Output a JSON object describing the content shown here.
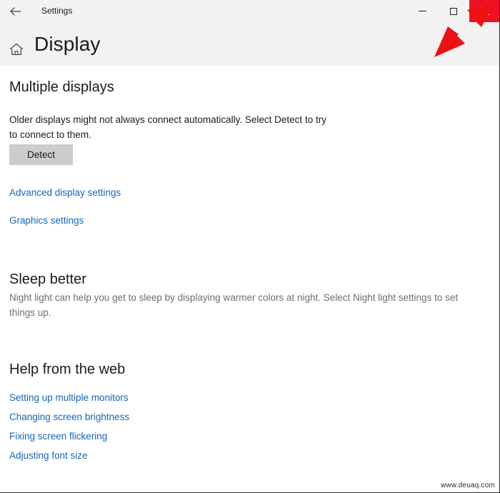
{
  "window": {
    "app_title": "Settings",
    "back_icon": "back-arrow-icon",
    "minimize_label": "—",
    "maximize_label": "□",
    "close_label": "✕"
  },
  "header": {
    "home_icon": "home-icon",
    "page_title": "Display"
  },
  "sections": {
    "multiple_displays": {
      "heading": "Multiple displays",
      "description": "Older displays might not always connect automatically. Select Detect to try to connect to them.",
      "detect_button": "Detect",
      "links": [
        {
          "label": "Advanced display settings"
        },
        {
          "label": "Graphics settings"
        }
      ]
    },
    "sleep_better": {
      "heading": "Sleep better",
      "description": "Night light can help you get to sleep by displaying warmer colors at night. Select Night light settings to set things up."
    },
    "help_from_web": {
      "heading": "Help from the web",
      "links": [
        {
          "label": "Setting up multiple monitors"
        },
        {
          "label": "Changing screen brightness"
        },
        {
          "label": "Fixing screen flickering"
        },
        {
          "label": "Adjusting font size"
        }
      ]
    }
  },
  "annotation": {
    "arrow_icon": "red-arrow-annotation",
    "target": "close-button"
  },
  "watermark": {
    "text": "www.deuaq.com"
  },
  "colors": {
    "accent_link": "#1367ba",
    "close_button_red": "#ee1122",
    "annotation_red": "#ee1111",
    "chrome_background": "#f2f2f2",
    "button_face": "#cccccc"
  }
}
